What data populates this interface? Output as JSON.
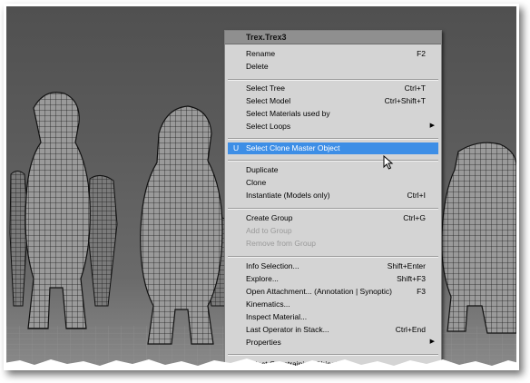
{
  "context_menu": {
    "title": "Trex.Trex3",
    "items": [
      {
        "label": "Rename",
        "shortcut": "F2"
      },
      {
        "label": "Delete",
        "shortcut": ""
      },
      {
        "label": "Select Tree",
        "shortcut": "Ctrl+T"
      },
      {
        "label": "Select Model",
        "shortcut": "Ctrl+Shift+T"
      },
      {
        "label": "Select Materials used by",
        "shortcut": ""
      },
      {
        "label": "Select Loops",
        "shortcut": ""
      },
      {
        "label": "Select Clone Master Object",
        "shortcut": "",
        "prefix": "U",
        "highlighted": true
      },
      {
        "label": "Duplicate",
        "shortcut": ""
      },
      {
        "label": "Clone",
        "shortcut": ""
      },
      {
        "label": "Instantiate (Models only)",
        "shortcut": "Ctrl+I"
      },
      {
        "label": "Create Group",
        "shortcut": "Ctrl+G"
      },
      {
        "label": "Add to Group",
        "shortcut": "",
        "disabled": true
      },
      {
        "label": "Remove from Group",
        "shortcut": "",
        "disabled": true
      },
      {
        "label": "Info Selection...",
        "shortcut": "Shift+Enter"
      },
      {
        "label": "Explore...",
        "shortcut": "Shift+F3"
      },
      {
        "label": "Open Attachment... (Annotation | Synoptic)",
        "shortcut": "F3"
      },
      {
        "label": "Kinematics...",
        "shortcut": ""
      },
      {
        "label": "Inspect Material...",
        "shortcut": ""
      },
      {
        "label": "Last Operator in Stack...",
        "shortcut": "Ctrl+End"
      },
      {
        "label": "Properties",
        "shortcut": ""
      },
      {
        "label": "Select Constraining Objects",
        "shortcut": ""
      }
    ]
  },
  "colors": {
    "highlight": "#3d8ee6",
    "menu_bg": "#d4d4d4",
    "title_bg": "#8f8f8f",
    "viewport_bg": "#5a5a5a"
  },
  "icons": {
    "submenu": "chevron-right-icon",
    "cursor": "mouse-pointer-icon"
  }
}
